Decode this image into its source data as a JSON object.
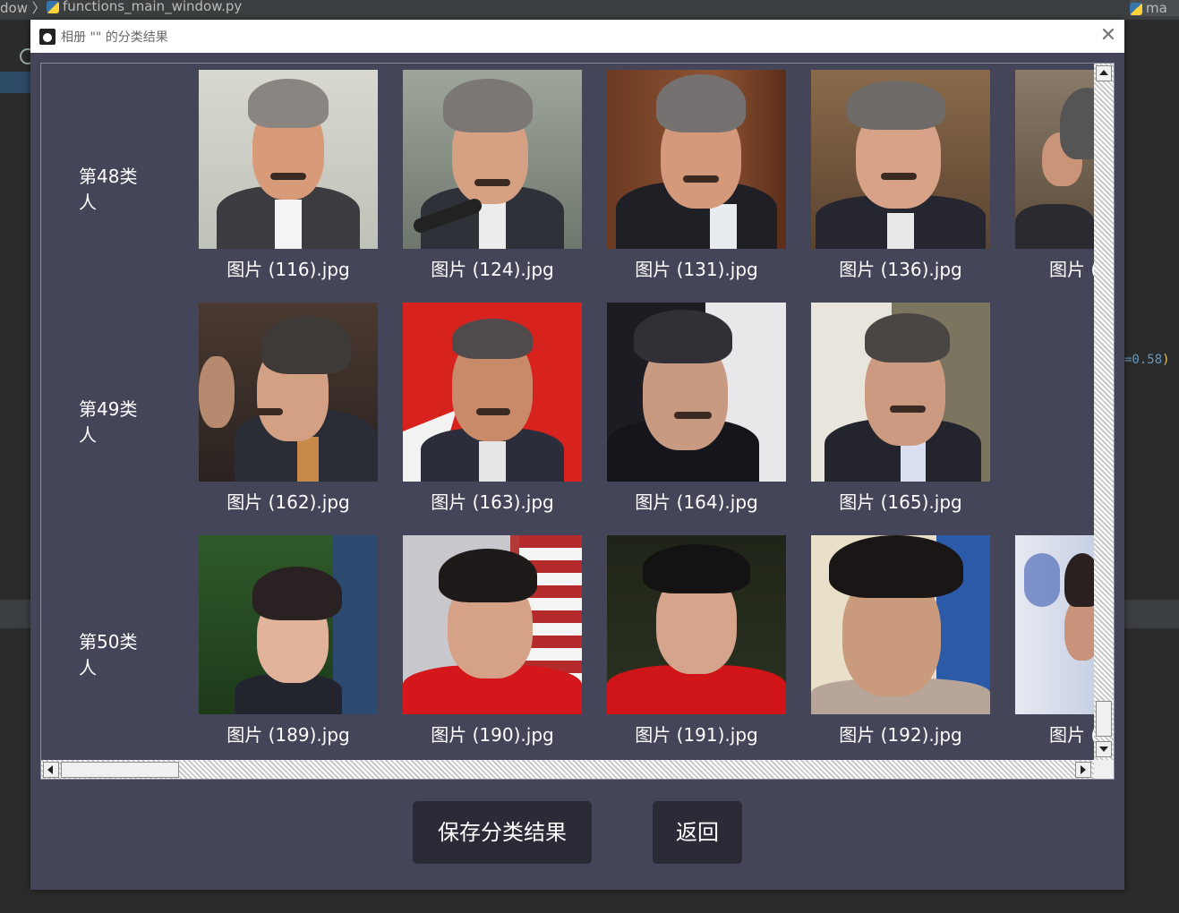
{
  "ide": {
    "breadcrumb": "dow 〉",
    "file_name": "functions_main_window.py",
    "right_tab": "ma",
    "code_value": "=0.58",
    "code_paren": ")"
  },
  "dialog": {
    "title": "相册 \"\" 的分类结果",
    "close_glyph": "✕"
  },
  "rows": [
    {
      "label": "第48类人",
      "images": [
        "图片 (116).jpg",
        "图片 (124).jpg",
        "图片 (131).jpg",
        "图片 (136).jpg",
        "图片 ("
      ]
    },
    {
      "label": "第49类人",
      "images": [
        "图片 (162).jpg",
        "图片 (163).jpg",
        "图片 (164).jpg",
        "图片 (165).jpg"
      ]
    },
    {
      "label": "第50类人",
      "images": [
        "图片 (189).jpg",
        "图片 (190).jpg",
        "图片 (191).jpg",
        "图片 (192).jpg",
        "图片 ("
      ]
    }
  ],
  "buttons": {
    "save": "保存分类结果",
    "back": "返回"
  },
  "colors": {
    "dialog_bg": "#444559",
    "button_bg": "#2a2b36",
    "text": "#ffffff"
  }
}
